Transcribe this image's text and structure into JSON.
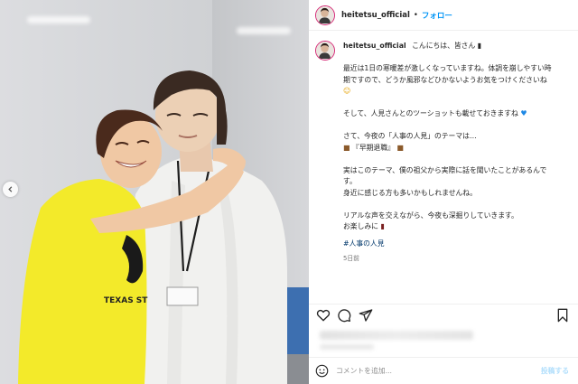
{
  "post": {
    "username": "heitetsu_official",
    "follow_label": "フォロー",
    "separator": "•",
    "caption_lines": [
      "こんにちは、皆さん",
      "",
      "最近は1日の寒暖差が激しくなっていますね。体調を崩しやすい時",
      "期ですので、どうか風邪などひかないようお気をつけくださいね",
      "",
      "そして、人見さんとのツーショットも載せておきますね",
      "さて、今夜の「人事の人見」のテーマは…",
      "『早期退職』",
      "実はこのテーマ、僕の祖父から実際に話を聞いたことがあるんで",
      "す。",
      "身近に感じる方も多いかもしれませんね。",
      "リアルな声を交えながら、今夜も深掘りしていきます。",
      "お楽しみに"
    ],
    "hashtag": "#人事の人見",
    "time_ago": "5日前"
  },
  "comment": {
    "placeholder": "コメントを追加...",
    "post_label": "投稿する"
  },
  "icons": {
    "like": "heart-icon",
    "comment": "comment-icon",
    "share": "paper-plane-icon",
    "save": "bookmark-icon",
    "emoji": "smiley-icon",
    "prev": "chevron-left-icon"
  },
  "colors": {
    "follow": "#0095f6",
    "hashtag": "#00376b",
    "muted": "#737373",
    "post_button_disabled": "#b2dffc"
  }
}
